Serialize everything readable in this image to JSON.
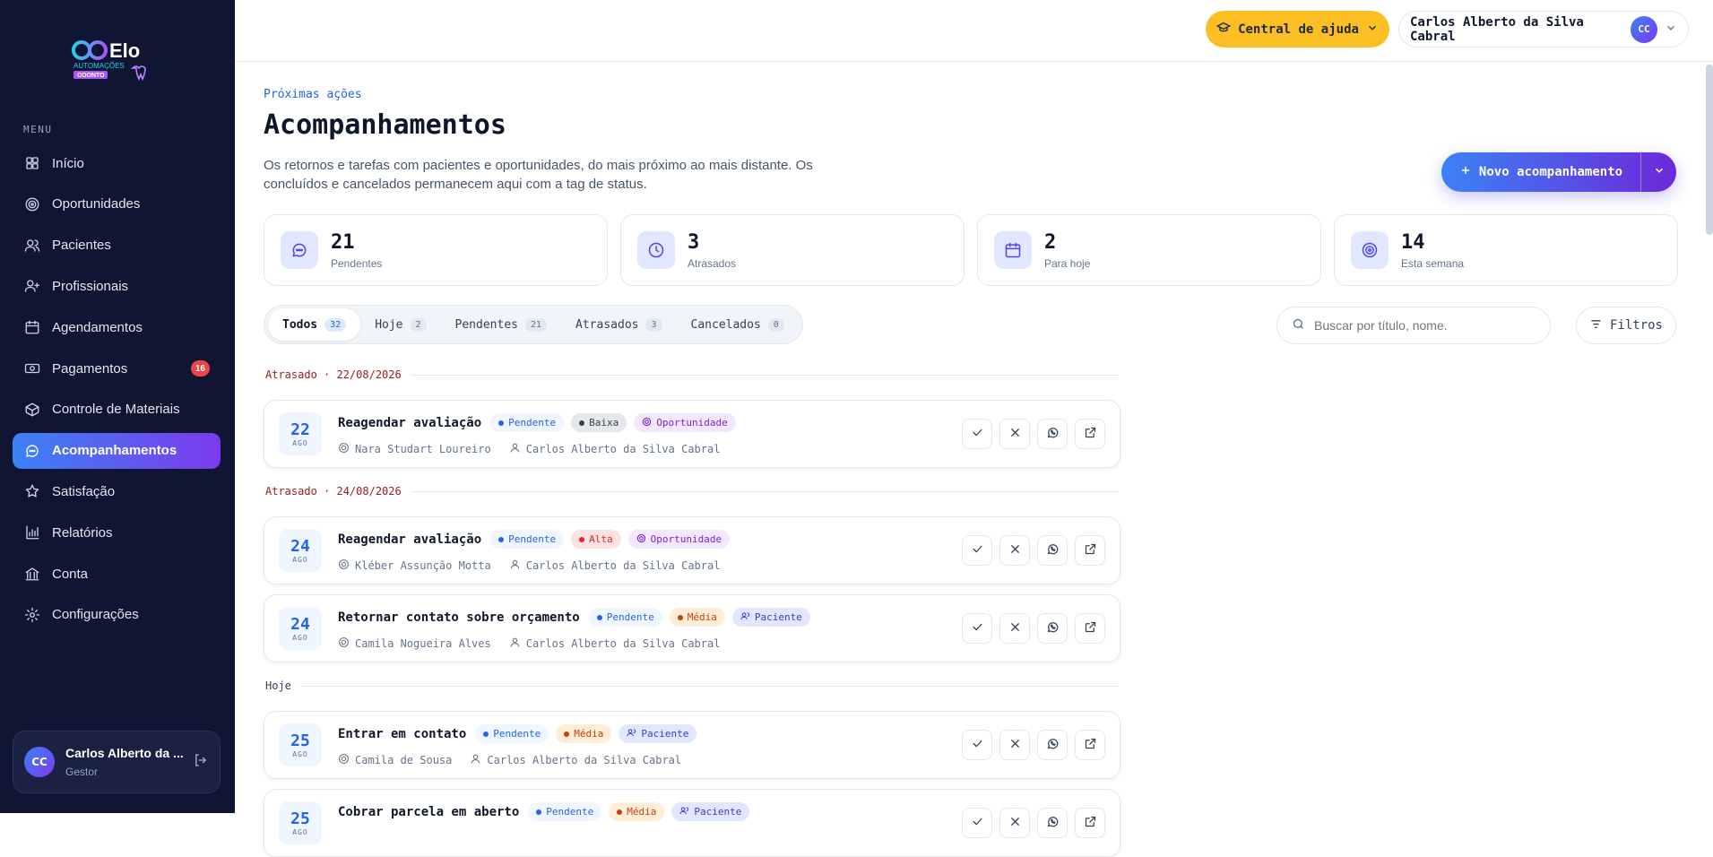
{
  "brand": {
    "name": "Elo",
    "sub1": "AUTOMAÇÕES",
    "sub2": "ODONTO"
  },
  "sidebar": {
    "menu_caption": "MENU",
    "items": [
      {
        "label": "Início",
        "icon": "grid-icon"
      },
      {
        "label": "Oportunidades",
        "icon": "target-icon"
      },
      {
        "label": "Pacientes",
        "icon": "users-icon"
      },
      {
        "label": "Profissionais",
        "icon": "user-plus-icon"
      },
      {
        "label": "Agendamentos",
        "icon": "calendar-icon"
      },
      {
        "label": "Pagamentos",
        "icon": "cash-icon",
        "badge": "16"
      },
      {
        "label": "Controle de Materiais",
        "icon": "box-icon"
      },
      {
        "label": "Acompanhamentos",
        "icon": "chat-icon",
        "active": true
      },
      {
        "label": "Satisfação",
        "icon": "star-icon"
      },
      {
        "label": "Relatórios",
        "icon": "bar-chart-icon"
      },
      {
        "label": "Conta",
        "icon": "bank-icon"
      },
      {
        "label": "Configurações",
        "icon": "gear-icon"
      }
    ],
    "user": {
      "initials": "CC",
      "name": "Carlos Alberto da ...",
      "role": "Gestor"
    }
  },
  "topbar": {
    "help_label": "Central de ajuda",
    "user_name": "Carlos Alberto da Silva Cabral",
    "user_initials": "CC"
  },
  "header": {
    "eyebrow": "Próximas ações",
    "title": "Acompanhamentos",
    "description": "Os retornos e tarefas com pacientes e oportunidades, do mais próximo ao mais distante. Os concluídos e cancelados permanecem aqui com a tag de status.",
    "new_button": "Novo acompanhamento"
  },
  "stats": [
    {
      "value": "21",
      "label": "Pendentes",
      "icon": "chat-icon"
    },
    {
      "value": "3",
      "label": "Atrasados",
      "icon": "clock-icon"
    },
    {
      "value": "2",
      "label": "Para hoje",
      "icon": "calendar-icon"
    },
    {
      "value": "14",
      "label": "Esta semana",
      "icon": "target-icon"
    }
  ],
  "tabs": [
    {
      "label": "Todos",
      "count": "32",
      "active": true
    },
    {
      "label": "Hoje",
      "count": "2"
    },
    {
      "label": "Pendentes",
      "count": "21"
    },
    {
      "label": "Atrasados",
      "count": "3"
    },
    {
      "label": "Cancelados",
      "count": "0"
    }
  ],
  "search": {
    "placeholder": "Buscar por título, nome."
  },
  "filters_label": "Filtros",
  "groups": [
    {
      "heading": "Atrasado · 22/08/2026",
      "kind": "overdue"
    },
    {
      "heading": "Atrasado · 24/08/2026",
      "kind": "overdue"
    },
    {
      "heading": "Hoje",
      "kind": "today"
    }
  ],
  "cards": [
    {
      "day": "22",
      "month": "AGO",
      "title": "Reagendar avaliação",
      "status": "Pendente",
      "priority": "Baixa",
      "priority_kind": "low",
      "type": "Oportunidade",
      "type_kind": "opp",
      "contact": "Nara Studart Loureiro",
      "owner": "Carlos Alberto da Silva Cabral"
    },
    {
      "day": "24",
      "month": "AGO",
      "title": "Reagendar avaliação",
      "status": "Pendente",
      "priority": "Alta",
      "priority_kind": "high",
      "type": "Oportunidade",
      "type_kind": "opp",
      "contact": "Kléber Assunção Motta",
      "owner": "Carlos Alberto da Silva Cabral"
    },
    {
      "day": "24",
      "month": "AGO",
      "title": "Retornar contato sobre orçamento",
      "status": "Pendente",
      "priority": "Média",
      "priority_kind": "mid",
      "type": "Paciente",
      "type_kind": "pat",
      "contact": "Camila Nogueira Alves",
      "owner": "Carlos Alberto da Silva Cabral"
    },
    {
      "day": "25",
      "month": "AGO",
      "title": "Entrar em contato",
      "status": "Pendente",
      "priority": "Média",
      "priority_kind": "mid",
      "type": "Paciente",
      "type_kind": "pat",
      "contact": "Camila de Sousa",
      "owner": "Carlos Alberto da Silva Cabral"
    },
    {
      "day": "25",
      "month": "AGO",
      "title": "Cobrar parcela em aberto",
      "status": "Pendente",
      "priority": "Média",
      "priority_kind": "mid",
      "type": "Paciente",
      "type_kind": "pat",
      "contact": "",
      "owner": ""
    }
  ]
}
